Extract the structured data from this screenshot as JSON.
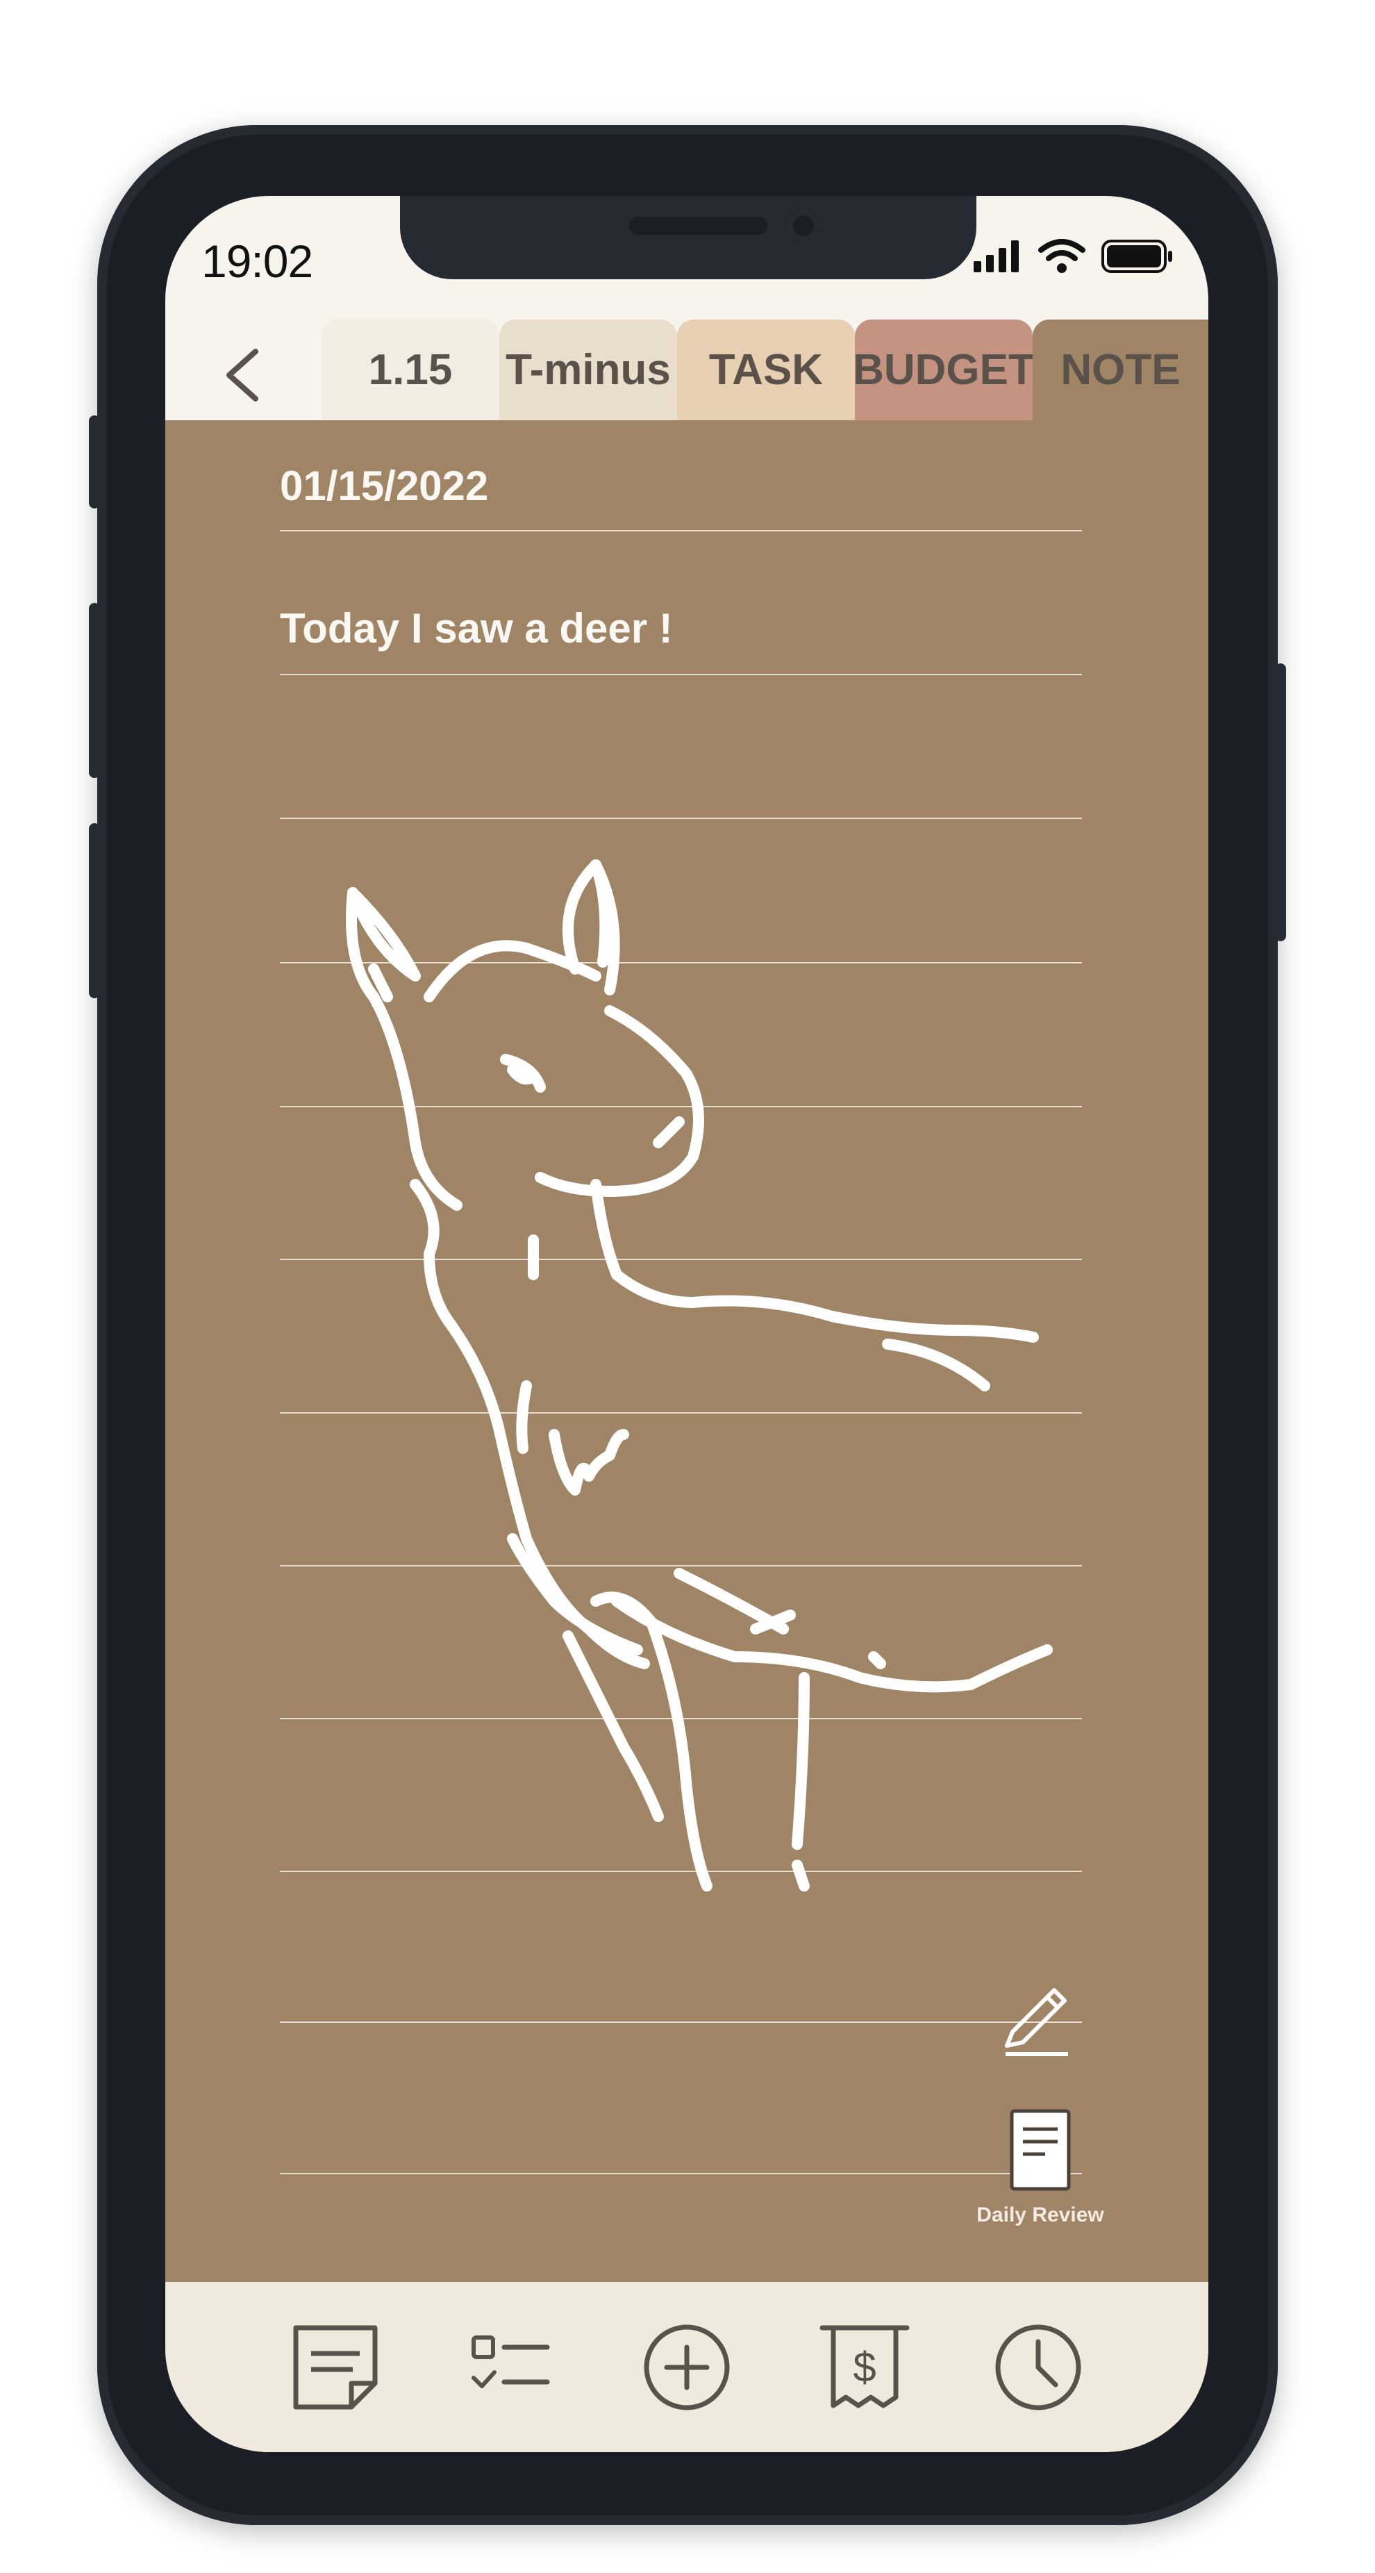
{
  "status_bar": {
    "time": "19:02"
  },
  "tabs": [
    {
      "label": "1.15",
      "bg": "#f3ece3"
    },
    {
      "label": "T-minus",
      "bg": "#e9ddcb"
    },
    {
      "label": "TASK",
      "bg": "#e7cfb2"
    },
    {
      "label": "BUDGET",
      "bg": "#c49381"
    },
    {
      "label": "NOTE",
      "bg": "#a08466"
    }
  ],
  "note": {
    "date": "01/15/2022",
    "text": "Today I saw a deer !"
  },
  "tools": {
    "daily_review_label": "Daily Review"
  },
  "colors": {
    "note_background": "#a08466",
    "ink": "#ffffff",
    "bottom_bar": "#f0e9dd",
    "icon_stroke": "#5a514a"
  },
  "bottom_nav": [
    "notes-icon",
    "checklist-icon",
    "add-icon",
    "receipt-dollar-icon",
    "clock-icon"
  ]
}
